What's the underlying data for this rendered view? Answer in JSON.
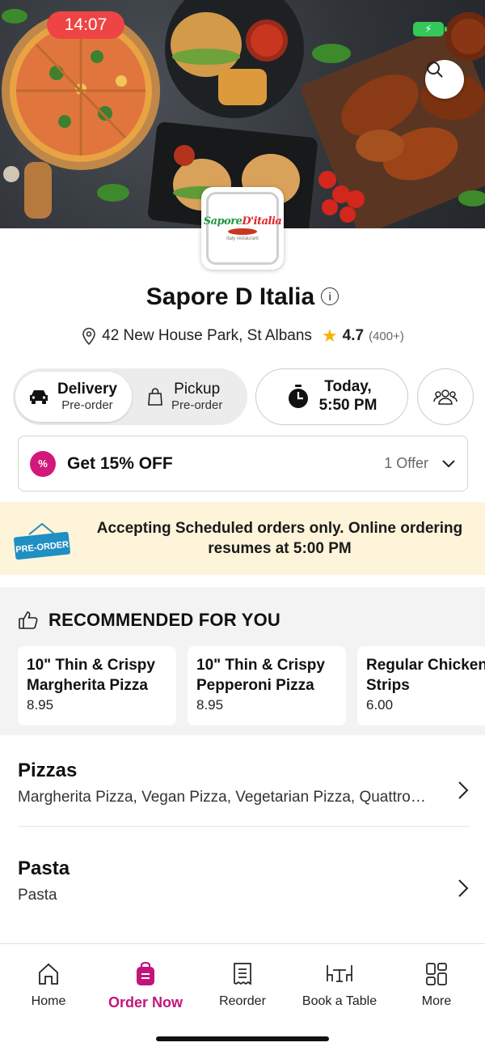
{
  "status": {
    "time": "14:07"
  },
  "restaurant": {
    "name": "Sapore D Italia",
    "logo_text_a": "Sapore",
    "logo_text_b": "D'italia",
    "logo_sub": "Italy restaurant",
    "address": "42 New House Park, St Albans",
    "rating": "4.7",
    "rating_count": "(400+)"
  },
  "modes": [
    {
      "label": "Delivery",
      "sub": "Pre-order",
      "selected": true
    },
    {
      "label": "Pickup",
      "sub": "Pre-order",
      "selected": false
    }
  ],
  "schedule": {
    "line1": "Today,",
    "line2": "5:50 PM"
  },
  "offer": {
    "title": "Get 15% OFF",
    "count": "1 Offer",
    "badge": "%"
  },
  "banner": {
    "tag": "PRE-ORDER",
    "text": "Accepting Scheduled orders only. Online ordering resumes at 5:00 PM"
  },
  "recommended": {
    "heading": "RECOMMENDED FOR YOU",
    "items": [
      {
        "line1": "10\" Thin & Crispy",
        "line2": "Margherita Pizza",
        "price": "8.95"
      },
      {
        "line1": "10\" Thin & Crispy",
        "line2": "Pepperoni Pizza",
        "price": "8.95"
      },
      {
        "line1": "Regular Chicken",
        "line2": "Strips",
        "price": "6.00"
      }
    ]
  },
  "categories": [
    {
      "name": "Pizzas",
      "desc": "Margherita Pizza, Vegan Pizza, Vegetarian Pizza, Quattro Formaggi Pizza"
    },
    {
      "name": "Pasta",
      "desc": "Pasta"
    }
  ],
  "tabs": [
    {
      "label": "Home",
      "icon": "home-icon",
      "active": false
    },
    {
      "label": "Order Now",
      "icon": "order-bag-icon",
      "active": true
    },
    {
      "label": "Reorder",
      "icon": "receipt-icon",
      "active": false
    },
    {
      "label": "Book a Table",
      "icon": "table-icon",
      "active": false
    },
    {
      "label": "More",
      "icon": "grid-icon",
      "active": false
    }
  ],
  "colors": {
    "accent": "#c2157b",
    "banner_bg": "#fdf4d9",
    "star": "#f5b301",
    "time_pill": "#ef4444"
  }
}
